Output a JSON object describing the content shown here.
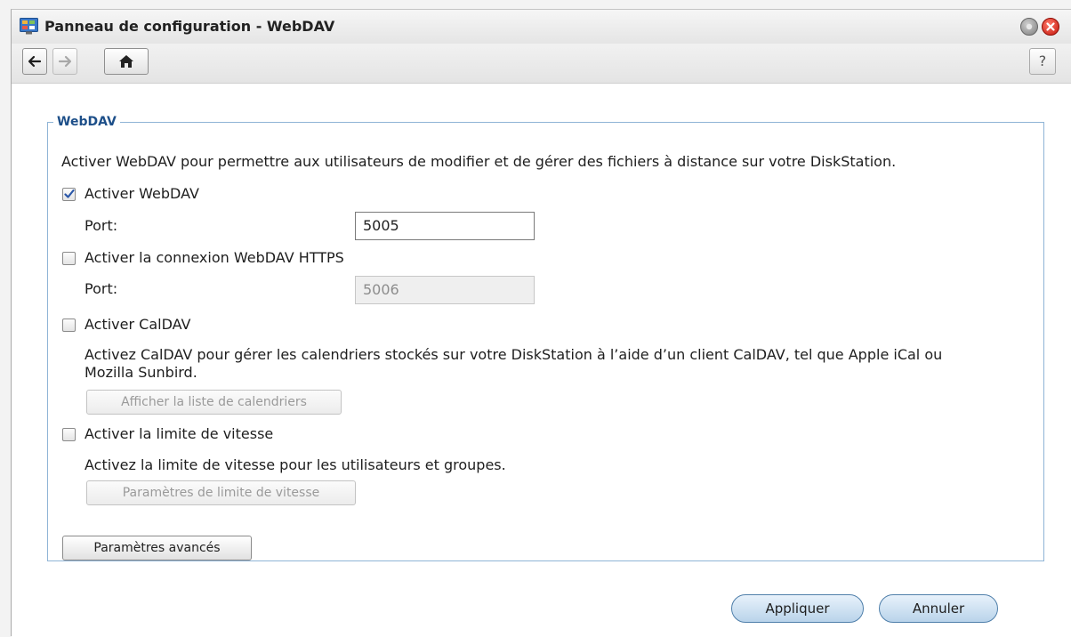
{
  "window": {
    "title": "Panneau de configuration - WebDAV",
    "help_label": "?"
  },
  "icons": {
    "app": "control-panel-icon",
    "back": "arrow-left-icon",
    "forward": "arrow-right-icon",
    "home": "home-icon",
    "minimize": "minimize-icon",
    "close": "close-icon"
  },
  "group": {
    "legend": "WebDAV",
    "description": "Activer WebDAV pour permettre aux utilisateurs de modifier et de gérer des fichiers à distance sur votre DiskStation.",
    "webdav": {
      "label": "Activer WebDAV",
      "checked": true,
      "port_label": "Port:",
      "port_value": "5005"
    },
    "https": {
      "label": "Activer la connexion WebDAV HTTPS",
      "checked": false,
      "port_label": "Port:",
      "port_value": "5006"
    },
    "caldav": {
      "label": "Activer CalDAV",
      "checked": false,
      "description_line1": "Activez CalDAV pour gérer les calendriers stockés sur votre DiskStation à l’aide d’un client CalDAV, tel que Apple iCal ou",
      "description_line2": "Mozilla Sunbird.",
      "list_button": "Afficher la liste de calendriers"
    },
    "speed": {
      "label": "Activer la limite de vitesse",
      "checked": false,
      "description": "Activez la limite de vitesse pour les utilisateurs et groupes.",
      "settings_button": "Paramètres de limite de vitesse"
    },
    "advanced_button": "Paramètres avancés"
  },
  "footer": {
    "apply": "Appliquer",
    "cancel": "Annuler"
  },
  "colors": {
    "legend": "#1d4f89",
    "group_border": "#8fb4d6",
    "pill_bottom": "#b9d3ea",
    "close": "#c3140a"
  }
}
